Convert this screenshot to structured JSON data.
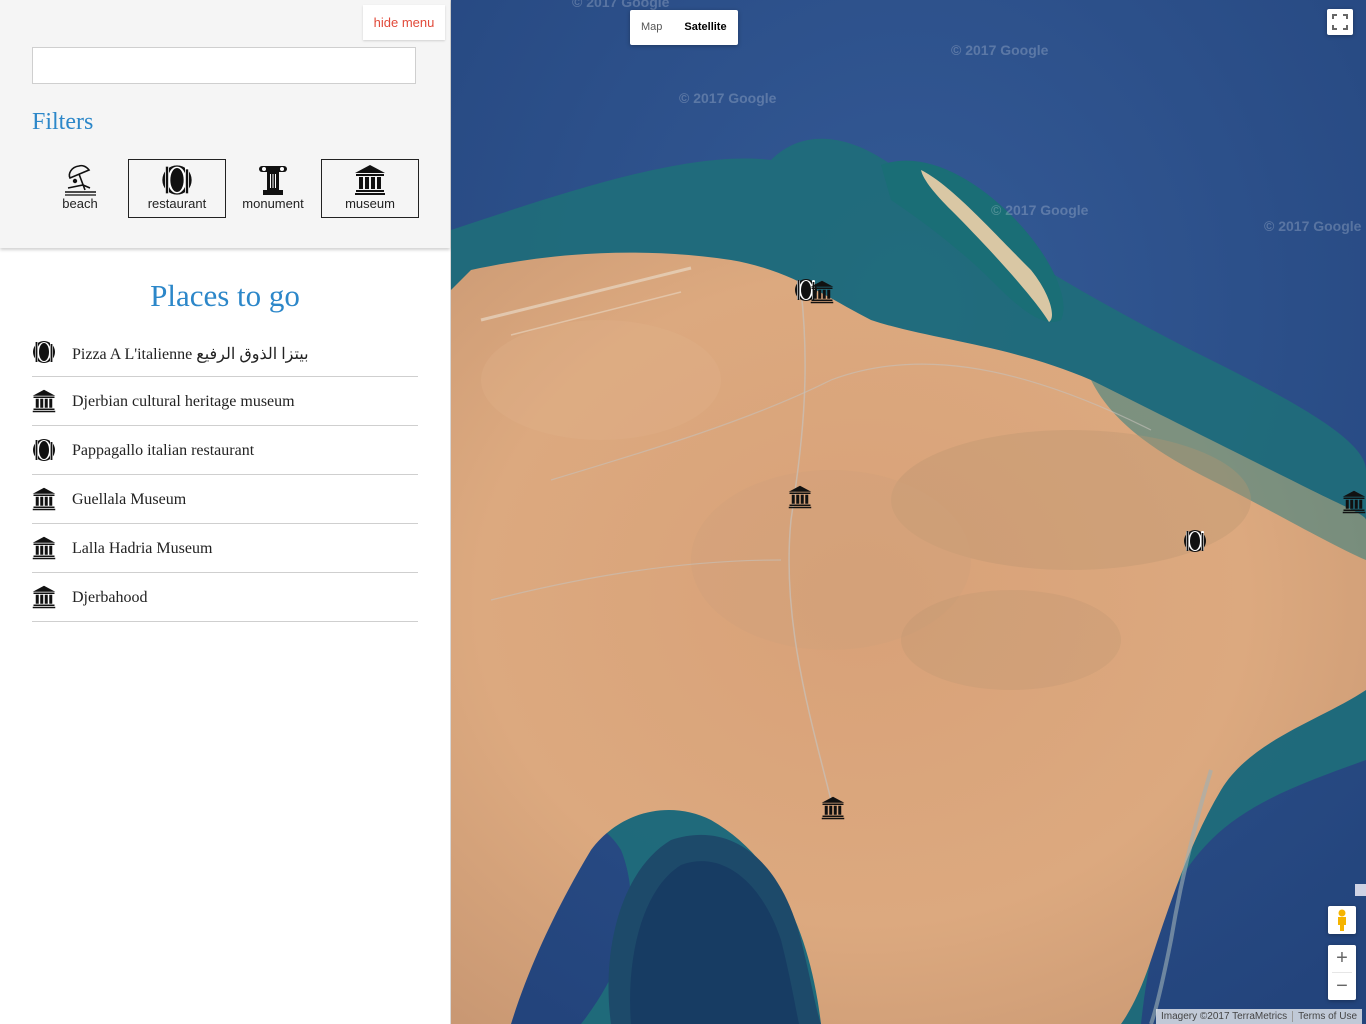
{
  "sidebar": {
    "hide_menu_label": "hide menu",
    "search": {
      "value": "",
      "placeholder": ""
    },
    "filters_title": "Filters",
    "filters": [
      {
        "label": "beach",
        "icon": "beach-icon",
        "active": false
      },
      {
        "label": "restaurant",
        "icon": "restaurant-icon",
        "active": true
      },
      {
        "label": "monument",
        "icon": "monument-icon",
        "active": false
      },
      {
        "label": "museum",
        "icon": "museum-icon",
        "active": true
      }
    ],
    "places_title": "Places to go",
    "places": [
      {
        "name": "Pizza A L'italienne بيتزا الذوق الرفيع",
        "icon": "restaurant-icon"
      },
      {
        "name": "Djerbian cultural heritage museum",
        "icon": "museum-icon"
      },
      {
        "name": "Pappagallo italian restaurant",
        "icon": "restaurant-icon"
      },
      {
        "name": "Guellala Museum",
        "icon": "museum-icon"
      },
      {
        "name": "Lalla Hadria Museum",
        "icon": "museum-icon"
      },
      {
        "name": "Djerbahood",
        "icon": "museum-icon"
      }
    ]
  },
  "map": {
    "map_type_options": [
      "Map",
      "Satellite"
    ],
    "selected_map_type": "Satellite",
    "watermark": "© 2017 Google",
    "zoom_in_label": "+",
    "zoom_out_label": "−",
    "attribution_imagery": "Imagery ©2017 TerraMetrics",
    "attribution_terms": "Terms of Use",
    "colors": {
      "sea": "#2d4d88",
      "shallow_water": "#1f6e7a",
      "land": "#d9a57c"
    }
  },
  "colors": {
    "accent": "#2c87c9",
    "hide_menu_text": "#e14a3a",
    "panel_bg": "#f5f5f5"
  }
}
